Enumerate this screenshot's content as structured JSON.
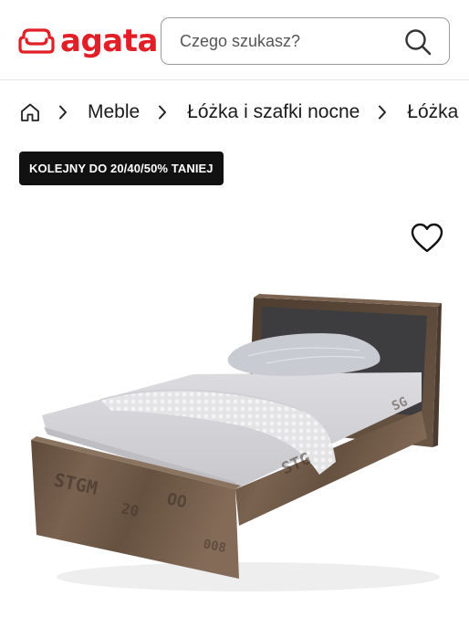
{
  "header": {
    "logo": {
      "text": "agata",
      "brand_color": "#e21e26",
      "icon": "sofa-logo-icon"
    },
    "search": {
      "placeholder": "Czego szukasz?",
      "value": "",
      "icon": "search-icon"
    }
  },
  "breadcrumb": {
    "home_icon": "home-icon",
    "separator_icon": "chevron-right-icon",
    "items": [
      "Meble",
      "Łóżka i szafki nocne",
      "Łóżka"
    ]
  },
  "promo_badge": {
    "label": "KOLEJNY DO 20/40/50% TANIEJ"
  },
  "product": {
    "favorite_icon": "heart-icon",
    "image": "single-bed-product-image"
  },
  "colors": {
    "brand": "#e21e26",
    "badge_bg": "#111111",
    "wood": "#6e5745",
    "headboard_panel": "#3d3d40",
    "mattress": "#d8d8dc"
  }
}
